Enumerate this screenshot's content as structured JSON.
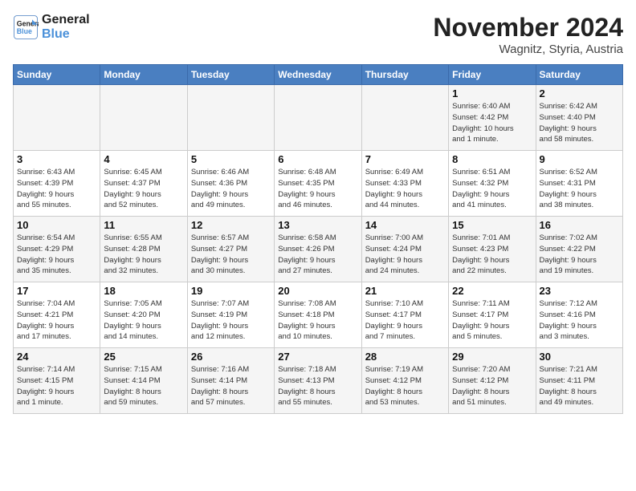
{
  "logo": {
    "line1": "General",
    "line2": "Blue"
  },
  "title": "November 2024",
  "location": "Wagnitz, Styria, Austria",
  "weekdays": [
    "Sunday",
    "Monday",
    "Tuesday",
    "Wednesday",
    "Thursday",
    "Friday",
    "Saturday"
  ],
  "weeks": [
    [
      {
        "day": "",
        "info": ""
      },
      {
        "day": "",
        "info": ""
      },
      {
        "day": "",
        "info": ""
      },
      {
        "day": "",
        "info": ""
      },
      {
        "day": "",
        "info": ""
      },
      {
        "day": "1",
        "info": "Sunrise: 6:40 AM\nSunset: 4:42 PM\nDaylight: 10 hours\nand 1 minute."
      },
      {
        "day": "2",
        "info": "Sunrise: 6:42 AM\nSunset: 4:40 PM\nDaylight: 9 hours\nand 58 minutes."
      }
    ],
    [
      {
        "day": "3",
        "info": "Sunrise: 6:43 AM\nSunset: 4:39 PM\nDaylight: 9 hours\nand 55 minutes."
      },
      {
        "day": "4",
        "info": "Sunrise: 6:45 AM\nSunset: 4:37 PM\nDaylight: 9 hours\nand 52 minutes."
      },
      {
        "day": "5",
        "info": "Sunrise: 6:46 AM\nSunset: 4:36 PM\nDaylight: 9 hours\nand 49 minutes."
      },
      {
        "day": "6",
        "info": "Sunrise: 6:48 AM\nSunset: 4:35 PM\nDaylight: 9 hours\nand 46 minutes."
      },
      {
        "day": "7",
        "info": "Sunrise: 6:49 AM\nSunset: 4:33 PM\nDaylight: 9 hours\nand 44 minutes."
      },
      {
        "day": "8",
        "info": "Sunrise: 6:51 AM\nSunset: 4:32 PM\nDaylight: 9 hours\nand 41 minutes."
      },
      {
        "day": "9",
        "info": "Sunrise: 6:52 AM\nSunset: 4:31 PM\nDaylight: 9 hours\nand 38 minutes."
      }
    ],
    [
      {
        "day": "10",
        "info": "Sunrise: 6:54 AM\nSunset: 4:29 PM\nDaylight: 9 hours\nand 35 minutes."
      },
      {
        "day": "11",
        "info": "Sunrise: 6:55 AM\nSunset: 4:28 PM\nDaylight: 9 hours\nand 32 minutes."
      },
      {
        "day": "12",
        "info": "Sunrise: 6:57 AM\nSunset: 4:27 PM\nDaylight: 9 hours\nand 30 minutes."
      },
      {
        "day": "13",
        "info": "Sunrise: 6:58 AM\nSunset: 4:26 PM\nDaylight: 9 hours\nand 27 minutes."
      },
      {
        "day": "14",
        "info": "Sunrise: 7:00 AM\nSunset: 4:24 PM\nDaylight: 9 hours\nand 24 minutes."
      },
      {
        "day": "15",
        "info": "Sunrise: 7:01 AM\nSunset: 4:23 PM\nDaylight: 9 hours\nand 22 minutes."
      },
      {
        "day": "16",
        "info": "Sunrise: 7:02 AM\nSunset: 4:22 PM\nDaylight: 9 hours\nand 19 minutes."
      }
    ],
    [
      {
        "day": "17",
        "info": "Sunrise: 7:04 AM\nSunset: 4:21 PM\nDaylight: 9 hours\nand 17 minutes."
      },
      {
        "day": "18",
        "info": "Sunrise: 7:05 AM\nSunset: 4:20 PM\nDaylight: 9 hours\nand 14 minutes."
      },
      {
        "day": "19",
        "info": "Sunrise: 7:07 AM\nSunset: 4:19 PM\nDaylight: 9 hours\nand 12 minutes."
      },
      {
        "day": "20",
        "info": "Sunrise: 7:08 AM\nSunset: 4:18 PM\nDaylight: 9 hours\nand 10 minutes."
      },
      {
        "day": "21",
        "info": "Sunrise: 7:10 AM\nSunset: 4:17 PM\nDaylight: 9 hours\nand 7 minutes."
      },
      {
        "day": "22",
        "info": "Sunrise: 7:11 AM\nSunset: 4:17 PM\nDaylight: 9 hours\nand 5 minutes."
      },
      {
        "day": "23",
        "info": "Sunrise: 7:12 AM\nSunset: 4:16 PM\nDaylight: 9 hours\nand 3 minutes."
      }
    ],
    [
      {
        "day": "24",
        "info": "Sunrise: 7:14 AM\nSunset: 4:15 PM\nDaylight: 9 hours\nand 1 minute."
      },
      {
        "day": "25",
        "info": "Sunrise: 7:15 AM\nSunset: 4:14 PM\nDaylight: 8 hours\nand 59 minutes."
      },
      {
        "day": "26",
        "info": "Sunrise: 7:16 AM\nSunset: 4:14 PM\nDaylight: 8 hours\nand 57 minutes."
      },
      {
        "day": "27",
        "info": "Sunrise: 7:18 AM\nSunset: 4:13 PM\nDaylight: 8 hours\nand 55 minutes."
      },
      {
        "day": "28",
        "info": "Sunrise: 7:19 AM\nSunset: 4:12 PM\nDaylight: 8 hours\nand 53 minutes."
      },
      {
        "day": "29",
        "info": "Sunrise: 7:20 AM\nSunset: 4:12 PM\nDaylight: 8 hours\nand 51 minutes."
      },
      {
        "day": "30",
        "info": "Sunrise: 7:21 AM\nSunset: 4:11 PM\nDaylight: 8 hours\nand 49 minutes."
      }
    ]
  ]
}
